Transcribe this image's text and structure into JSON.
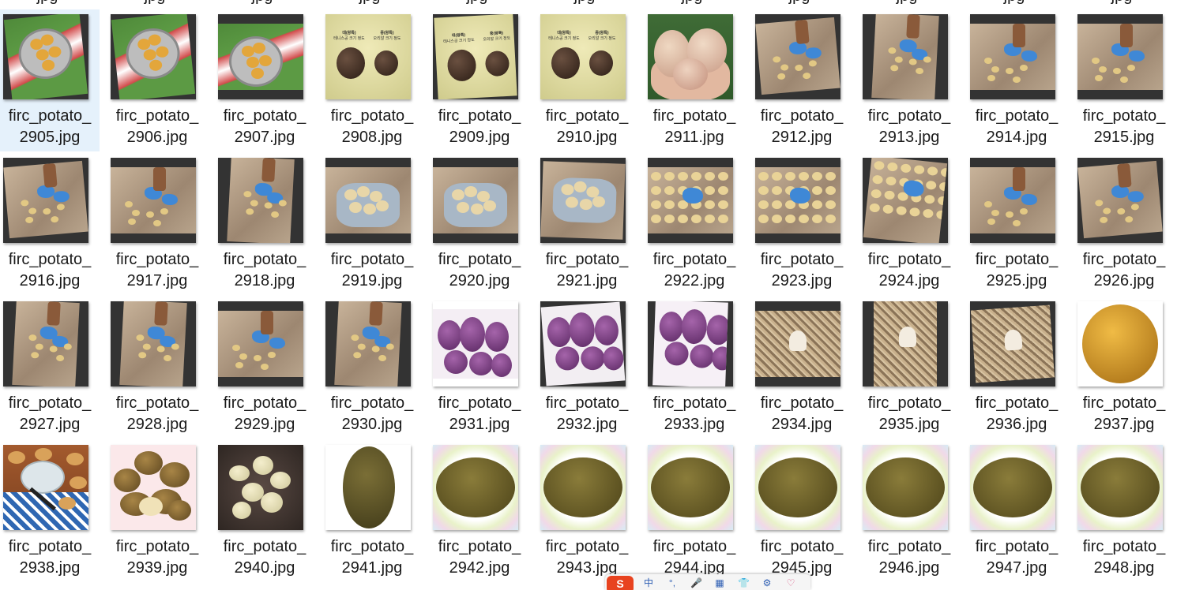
{
  "previous_row_labels": [
    "jpg",
    "jpg",
    "jpg",
    "jpg",
    "jpg",
    "jpg",
    "jpg",
    "jpg",
    "jpg",
    "jpg",
    "jpg"
  ],
  "files": [
    {
      "line1": "firc_potato_",
      "line2": "2905.jpg",
      "art": "basket-tilt",
      "selected": true
    },
    {
      "line1": "firc_potato_",
      "line2": "2906.jpg",
      "art": "basket-tilt"
    },
    {
      "line1": "firc_potato_",
      "line2": "2907.jpg",
      "art": "basket-flat"
    },
    {
      "line1": "firc_potato_",
      "line2": "2908.jpg",
      "art": "poster"
    },
    {
      "line1": "firc_potato_",
      "line2": "2909.jpg",
      "art": "poster-tilt"
    },
    {
      "line1": "firc_potato_",
      "line2": "2910.jpg",
      "art": "poster"
    },
    {
      "line1": "firc_potato_",
      "line2": "2911.jpg",
      "art": "hand-potatoes"
    },
    {
      "line1": "firc_potato_",
      "line2": "2912.jpg",
      "art": "dig-tilt"
    },
    {
      "line1": "firc_potato_",
      "line2": "2913.jpg",
      "art": "dig-portrait"
    },
    {
      "line1": "firc_potato_",
      "line2": "2914.jpg",
      "art": "dig"
    },
    {
      "line1": "firc_potato_",
      "line2": "2915.jpg",
      "art": "dig"
    },
    {
      "line1": "firc_potato_",
      "line2": "2916.jpg",
      "art": "dig-tilt"
    },
    {
      "line1": "firc_potato_",
      "line2": "2917.jpg",
      "art": "dig"
    },
    {
      "line1": "firc_potato_",
      "line2": "2918.jpg",
      "art": "dig-portrait"
    },
    {
      "line1": "firc_potato_",
      "line2": "2919.jpg",
      "art": "handful"
    },
    {
      "line1": "firc_potato_",
      "line2": "2920.jpg",
      "art": "handful"
    },
    {
      "line1": "firc_potato_",
      "line2": "2921.jpg",
      "art": "handful-tilt"
    },
    {
      "line1": "firc_potato_",
      "line2": "2922.jpg",
      "art": "pile"
    },
    {
      "line1": "firc_potato_",
      "line2": "2923.jpg",
      "art": "pile"
    },
    {
      "line1": "firc_potato_",
      "line2": "2924.jpg",
      "art": "pile-tilt"
    },
    {
      "line1": "firc_potato_",
      "line2": "2925.jpg",
      "art": "dig"
    },
    {
      "line1": "firc_potato_",
      "line2": "2926.jpg",
      "art": "dig-tilt"
    },
    {
      "line1": "firc_potato_",
      "line2": "2927.jpg",
      "art": "dig-portrait"
    },
    {
      "line1": "firc_potato_",
      "line2": "2928.jpg",
      "art": "dig-portrait"
    },
    {
      "line1": "firc_potato_",
      "line2": "2929.jpg",
      "art": "dig"
    },
    {
      "line1": "firc_potato_",
      "line2": "2930.jpg",
      "art": "dig-portrait"
    },
    {
      "line1": "firc_potato_",
      "line2": "2931.jpg",
      "art": "purple"
    },
    {
      "line1": "firc_potato_",
      "line2": "2932.jpg",
      "art": "purple-tilt"
    },
    {
      "line1": "firc_potato_",
      "line2": "2933.jpg",
      "art": "purple-collage"
    },
    {
      "line1": "firc_potato_",
      "line2": "2934.jpg",
      "art": "sprout"
    },
    {
      "line1": "firc_potato_",
      "line2": "2935.jpg",
      "art": "sprout-portrait"
    },
    {
      "line1": "firc_potato_",
      "line2": "2936.jpg",
      "art": "sprout-tilt"
    },
    {
      "line1": "firc_potato_",
      "line2": "2937.jpg",
      "art": "single-gold"
    },
    {
      "line1": "firc_potato_",
      "line2": "2938.jpg",
      "art": "kitchen"
    },
    {
      "line1": "firc_potato_",
      "line2": "2939.jpg",
      "art": "russet-pile"
    },
    {
      "line1": "firc_potato_",
      "line2": "2940.jpg",
      "art": "soil-white"
    },
    {
      "line1": "firc_potato_",
      "line2": "2941.jpg",
      "art": "single-olive"
    },
    {
      "line1": "firc_potato_",
      "line2": "2942.jpg",
      "art": "olive-wide"
    },
    {
      "line1": "firc_potato_",
      "line2": "2943.jpg",
      "art": "olive-wide"
    },
    {
      "line1": "firc_potato_",
      "line2": "2944.jpg",
      "art": "olive-wide"
    },
    {
      "line1": "firc_potato_",
      "line2": "2945.jpg",
      "art": "olive-wide"
    },
    {
      "line1": "firc_potato_",
      "line2": "2946.jpg",
      "art": "olive-wide"
    },
    {
      "line1": "firc_potato_",
      "line2": "2947.jpg",
      "art": "olive-wide"
    },
    {
      "line1": "firc_potato_",
      "line2": "2948.jpg",
      "art": "olive-wide"
    }
  ],
  "poster_text": {
    "left_title": "대(왕특)",
    "left_sub": "테니스공 크기 정도",
    "right_title": "중(왕특)",
    "right_sub": "오리알 크기 정도"
  },
  "taskbar": {
    "logo": "S",
    "icons": [
      "中",
      "°,",
      "🎤",
      "▦",
      "👕",
      "⚙",
      "♡"
    ]
  },
  "colors": {
    "selection_bg": "#e5f1fb",
    "text": "#1a1a1a",
    "dark_frame": "#333333",
    "glove_blue": "#3f88d6",
    "purple": "#7b3b86",
    "olive": "#6f6a2c",
    "gold": "#d59a2a"
  }
}
